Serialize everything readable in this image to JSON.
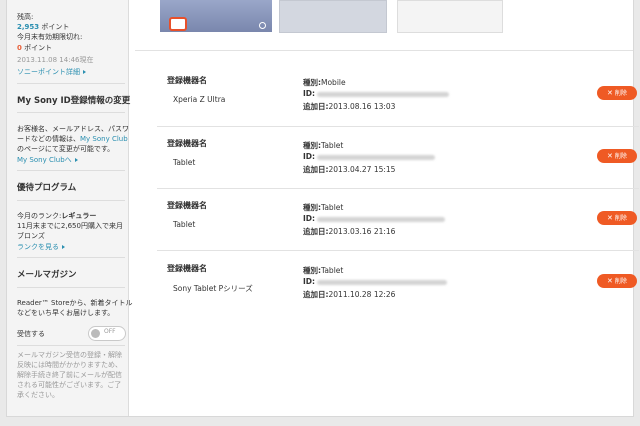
{
  "sidebar": {
    "balance_label": "残高:",
    "points_value": "2,953",
    "points_unit": "ポイント",
    "expiring_label": "今月末有効期限切れ:",
    "expiring_value": "0",
    "expiring_unit": "ポイント",
    "as_of": "2013.11.08 14:46現在",
    "points_link": "ソニーポイント詳細",
    "section_id_title": "My Sony ID登録情報の変更",
    "id_desc": [
      "お客様名、メールアドレス、パスワ",
      "ードなどの情報は、",
      "のページにて変更が可能です。"
    ],
    "id_desc_link": "My Sony Club",
    "id_link": "My Sony Clubへ",
    "section_program_title": "優待プログラム",
    "rank_label": "今月のランク:",
    "rank_value": "レギュラー",
    "rank_desc": [
      "11月末までに2,650円購入で来月",
      "ブロンズ"
    ],
    "rank_link": "ランクを見る",
    "section_mail_title": "メールマガジン",
    "mail_desc": [
      "Reader™ Storeから、新着タイトル",
      "などをいち早くお届けします。"
    ],
    "receive_label": "受信する",
    "toggle_state": "OFF",
    "mail_note": [
      "メールマガジン受信の登録・解除",
      "反映には時間がかかりますため、",
      "解除手続き終了前にメールが配信",
      "される可能性がございます。ご了",
      "承ください。"
    ]
  },
  "devices_header": {
    "name_label": "登録機器名",
    "type_label": "種別:",
    "id_label": "ID:",
    "added_label": "追加日:",
    "delete_label": "削除"
  },
  "devices": [
    {
      "name": "Xperia Z Ultra",
      "type": "Mobile",
      "added": "2013.08.16 13:03"
    },
    {
      "name": "Tablet",
      "type": "Tablet",
      "added": "2013.04.27 15:15"
    },
    {
      "name": "Tablet",
      "type": "Tablet",
      "added": "2013.03.16 21:16"
    },
    {
      "name": "Sony Tablet Pシリーズ",
      "type": "Tablet",
      "added": "2011.10.28 12:26"
    }
  ],
  "colors": {
    "accent": "#ef5a24",
    "link": "#2a8fb0"
  },
  "icons": {
    "badge": "tablet-icon",
    "search": "search-icon",
    "delete": "close-icon",
    "arrow": "chevron-right-icon"
  }
}
